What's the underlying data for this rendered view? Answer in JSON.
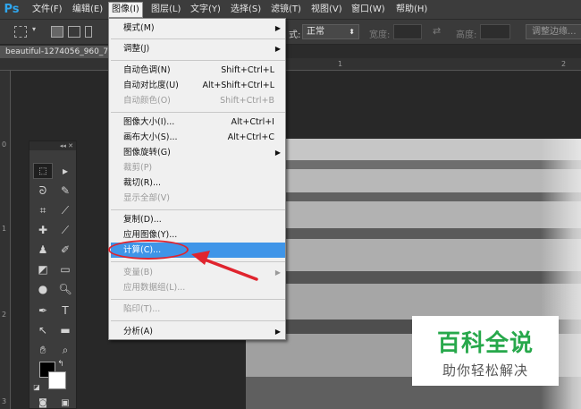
{
  "app": {
    "logo": "Ps"
  },
  "menubar": {
    "items": [
      {
        "label": "文件(F)"
      },
      {
        "label": "编辑(E)"
      },
      {
        "label": "图像(I)"
      },
      {
        "label": "图层(L)"
      },
      {
        "label": "文字(Y)"
      },
      {
        "label": "选择(S)"
      },
      {
        "label": "滤镜(T)"
      },
      {
        "label": "视图(V)"
      },
      {
        "label": "窗口(W)"
      },
      {
        "label": "帮助(H)"
      }
    ]
  },
  "options": {
    "style_label": "式:",
    "style_value": "正常",
    "width_label": "宽度:",
    "height_label": "高度:",
    "refine_edge_label": "调整边缘..."
  },
  "document": {
    "tab_label": "beautiful-1274056_960_7",
    "ruler_top": [
      "2",
      "1",
      "2"
    ],
    "ruler_left": [
      "0",
      "1",
      "2",
      "3"
    ]
  },
  "image_menu": {
    "items": [
      {
        "label": "模式(M)",
        "shortcut": "",
        "submenu": true,
        "disabled": false
      },
      {
        "label": "调整(J)",
        "shortcut": "",
        "submenu": true,
        "disabled": false
      },
      {
        "label": "自动色调(N)",
        "shortcut": "Shift+Ctrl+L",
        "submenu": false,
        "disabled": false
      },
      {
        "label": "自动对比度(U)",
        "shortcut": "Alt+Shift+Ctrl+L",
        "submenu": false,
        "disabled": false
      },
      {
        "label": "自动颜色(O)",
        "shortcut": "Shift+Ctrl+B",
        "submenu": false,
        "disabled": true
      },
      {
        "label": "图像大小(I)...",
        "shortcut": "Alt+Ctrl+I",
        "submenu": false,
        "disabled": false
      },
      {
        "label": "画布大小(S)...",
        "shortcut": "Alt+Ctrl+C",
        "submenu": false,
        "disabled": false
      },
      {
        "label": "图像旋转(G)",
        "shortcut": "",
        "submenu": true,
        "disabled": false
      },
      {
        "label": "裁剪(P)",
        "shortcut": "",
        "submenu": false,
        "disabled": true
      },
      {
        "label": "裁切(R)...",
        "shortcut": "",
        "submenu": false,
        "disabled": false
      },
      {
        "label": "显示全部(V)",
        "shortcut": "",
        "submenu": false,
        "disabled": true
      },
      {
        "label": "复制(D)...",
        "shortcut": "",
        "submenu": false,
        "disabled": false
      },
      {
        "label": "应用图像(Y)...",
        "shortcut": "",
        "submenu": false,
        "disabled": false
      },
      {
        "label": "计算(C)...",
        "shortcut": "",
        "submenu": false,
        "disabled": false,
        "highlighted": true
      },
      {
        "label": "变量(B)",
        "shortcut": "",
        "submenu": true,
        "disabled": true
      },
      {
        "label": "应用数据组(L)...",
        "shortcut": "",
        "submenu": false,
        "disabled": true
      },
      {
        "label": "陷印(T)...",
        "shortcut": "",
        "submenu": false,
        "disabled": true
      },
      {
        "label": "分析(A)",
        "shortcut": "",
        "submenu": true,
        "disabled": false
      }
    ]
  },
  "tools_panel": {
    "header": "◂◂ ✕"
  },
  "watermark": {
    "title": "百科全说",
    "subtitle": "助你轻松解决"
  },
  "colors": {
    "highlight": "#3f95e8",
    "annotation": "#e0242e",
    "watermark_green": "#27a84b",
    "ps_blue": "#2fa6ee"
  }
}
